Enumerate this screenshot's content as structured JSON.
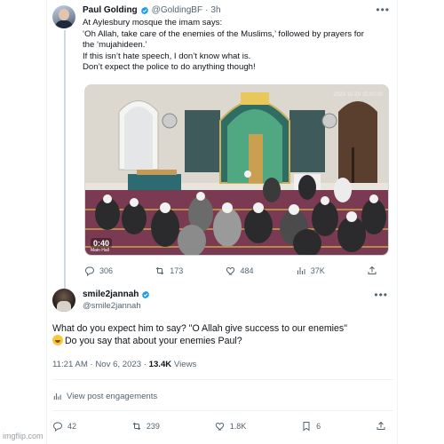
{
  "tweet": {
    "author_name": "Paul Golding",
    "author_handle": "@GoldingBF",
    "sep": "·",
    "age": "3h",
    "text_lines": [
      "At Aylesbury mosque the imam says:",
      "‘Oh Allah, take care of the enemies of the Muslims,’ followed by prayers for",
      "the ‘mujahideen.’",
      "If this isn’t hate speech, I don’t know what is.",
      "Don’t expect the police to do anything though!"
    ],
    "video": {
      "duration": "0:40",
      "timestamp": "2023-10-29 15:00:00",
      "caption": "Main Hall"
    },
    "stats": {
      "replies": "306",
      "retweets": "173",
      "likes": "484",
      "views": "37K"
    }
  },
  "reply": {
    "author_name": "smile2jannah",
    "author_handle": "@smile2jannah",
    "text_line1": "What do you expect him to say? \"O Allah give success to our enemies\"",
    "text_line2": "Do you say that about your enemies Paul?",
    "emoji": "rolling-on-floor-laughing",
    "time": "11:21 AM · Nov 6, 2023 · ",
    "views_count": "13.4K",
    "views_label": "Views",
    "engagements_label": "View post engagements",
    "stats": {
      "replies": "42",
      "retweets": "239",
      "likes": "1.8K",
      "bookmarks": "6"
    }
  },
  "watermark": "imgflip.com",
  "colors": {
    "verified": "#1d9bf0",
    "text": "#0f1419",
    "muted": "#536471"
  }
}
